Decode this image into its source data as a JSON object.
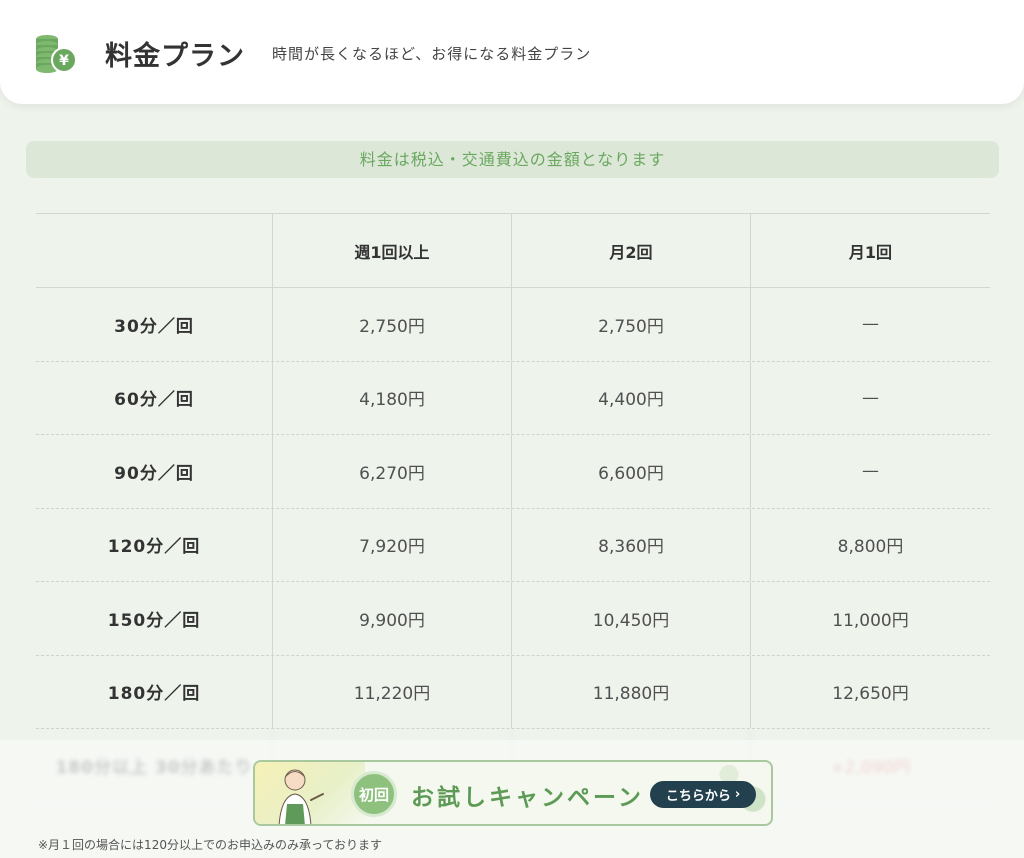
{
  "header": {
    "title": "料金プラン",
    "subtitle": "時間が長くなるほど、お得になる料金プラン",
    "icon": "coins-yen-icon",
    "accent": "#6aa860"
  },
  "notice": "料金は税込・交通費込の金額となります",
  "table": {
    "columns": [
      "",
      "週1回以上",
      "月2回",
      "月1回"
    ],
    "rows": [
      {
        "label": "30分／回",
        "c1": "2,750円",
        "c2": "2,750円",
        "c3": "—"
      },
      {
        "label": "60分／回",
        "c1": "4,180円",
        "c2": "4,400円",
        "c3": "—"
      },
      {
        "label": "90分／回",
        "c1": "6,270円",
        "c2": "6,600円",
        "c3": "—"
      },
      {
        "label": "120分／回",
        "c1": "7,920円",
        "c2": "8,360円",
        "c3": "8,800円"
      },
      {
        "label": "150分／回",
        "c1": "9,900円",
        "c2": "10,450円",
        "c3": "11,000円"
      },
      {
        "label": "180分／回",
        "c1": "11,220円",
        "c2": "11,880円",
        "c3": "12,650円"
      }
    ],
    "blurred_row": {
      "label": "180分以上 30分あたり",
      "c3": "+2,090円"
    }
  },
  "footnote": "※月１回の場合には120分以上でのお申込みのみ承っております",
  "banner": {
    "badge": "初回",
    "text": "お試しキャンペーン",
    "cta": "こちらから",
    "cta_icon": "chevron-right-icon"
  }
}
